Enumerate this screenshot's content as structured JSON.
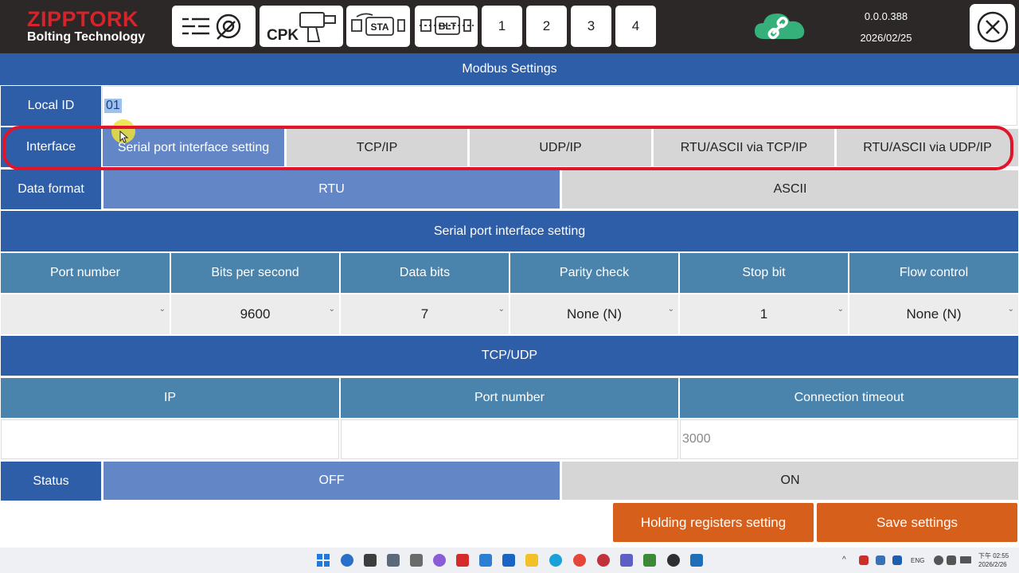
{
  "header": {
    "brand_name": "ZIPPTORK",
    "brand_tagline": "Bolting Technology",
    "cpk_label": "CPK",
    "sta_label": "STA",
    "blt_label": "BLT",
    "num_tabs": [
      "1",
      "2",
      "3",
      "4"
    ],
    "version": "0.0.0.388",
    "date": "2026/02/25"
  },
  "modbus": {
    "title": "Modbus Settings",
    "local_id_label": "Local ID",
    "local_id_value": "01",
    "interface_label": "Interface",
    "interfaces": [
      "Serial port interface setting",
      "TCP/IP",
      "UDP/IP",
      "RTU/ASCII via TCP/IP",
      "RTU/ASCII via UDP/IP"
    ],
    "selected_interface": "Serial port interface setting",
    "data_format_label": "Data format",
    "data_formats": [
      "RTU",
      "ASCII"
    ],
    "selected_data_format": "RTU"
  },
  "serial": {
    "title": "Serial port interface setting",
    "columns": [
      "Port number",
      "Bits per second",
      "Data bits",
      "Parity check",
      "Stop bit",
      "Flow control"
    ],
    "values": [
      "",
      "9600",
      "7",
      "None (N)",
      "1",
      "None (N)"
    ]
  },
  "tcpudp": {
    "title": "TCP/UDP",
    "columns": [
      "IP",
      "Port number",
      "Connection timeout"
    ],
    "values": [
      "",
      "",
      "3000"
    ]
  },
  "status": {
    "label": "Status",
    "options": [
      "OFF",
      "ON"
    ],
    "selected": "OFF"
  },
  "actions": {
    "holding_registers": "Holding registers setting",
    "save": "Save settings"
  },
  "taskbar": {
    "language": "ENG",
    "clock_time": "下午 02:55",
    "clock_date": "2026/2/26"
  },
  "colors": {
    "section_blue": "#2e5ea7",
    "header_blue": "#4a84ad",
    "selected_option": "#6387c6",
    "unselected_option": "#d6d6d6",
    "action_orange": "#d65f1c",
    "highlight_red": "#e0152a",
    "brand_red": "#d7232a"
  }
}
